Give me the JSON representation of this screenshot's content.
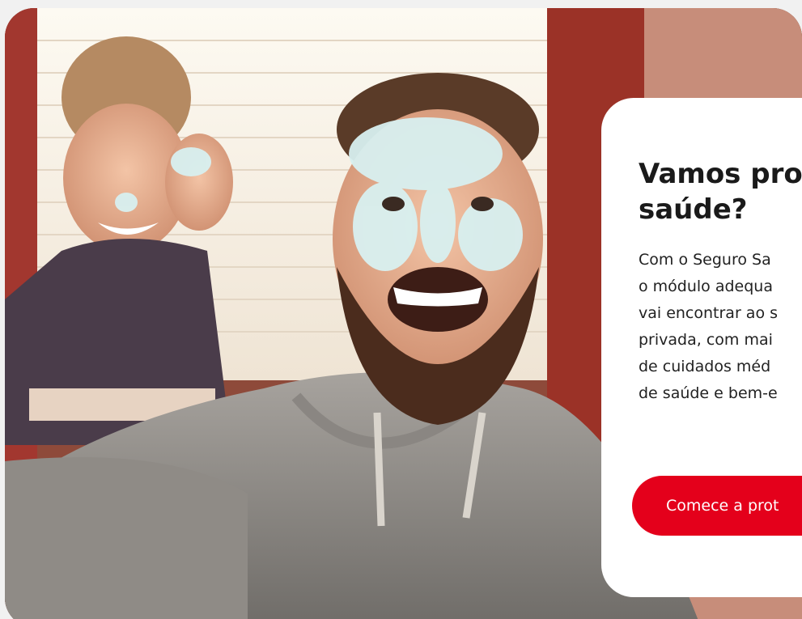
{
  "hero": {
    "image": "photo-father-daughter-selfie",
    "card": {
      "title_lines": [
        "Vamos pro",
        "saúde?"
      ],
      "body_lines": [
        "Com o Seguro Sa",
        "o módulo adequa",
        "vai encontrar ao s",
        "privada, com mai",
        "de cuidados méd",
        "de saúde e bem-e"
      ],
      "cta_label": "Comece a prot"
    }
  },
  "colors": {
    "brand_red": "#e4001b",
    "card_bg": "#ffffff",
    "page_bg": "#f1f1f1"
  }
}
